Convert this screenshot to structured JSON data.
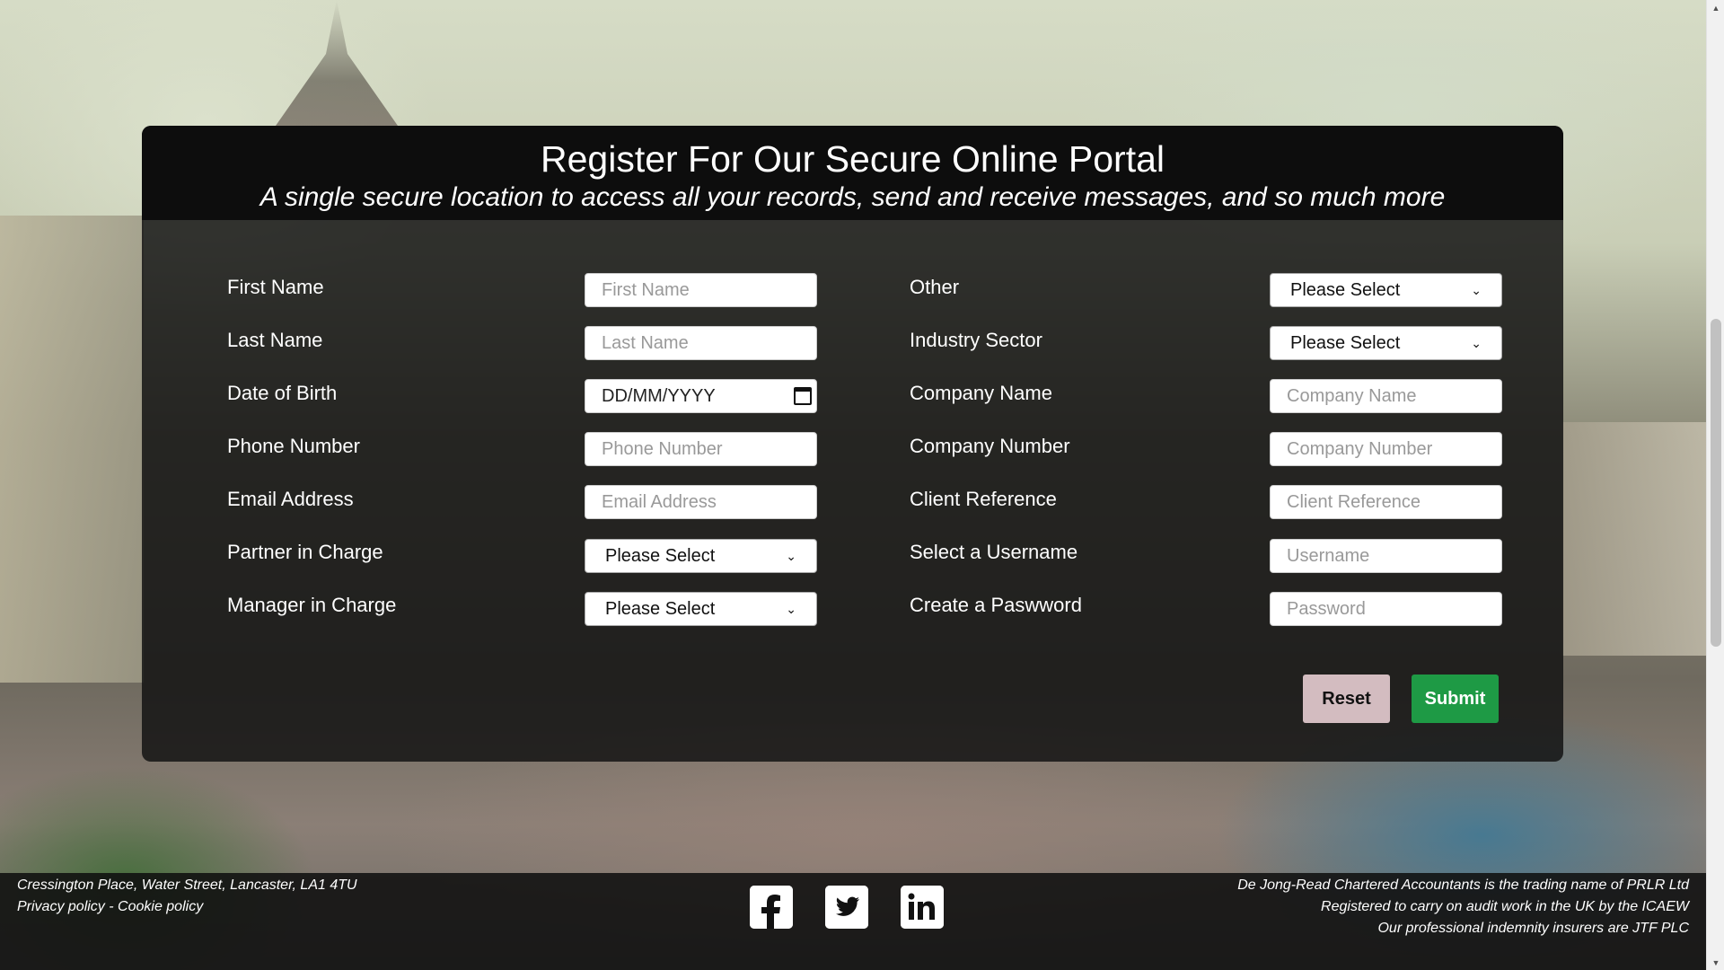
{
  "header": {
    "title": "Register For Our Secure Online Portal",
    "subtitle": "A single secure location to access all your records, send and receive messages, and so much more"
  },
  "form": {
    "left": [
      {
        "label": "First Name",
        "type": "text",
        "placeholder": "First Name"
      },
      {
        "label": "Last Name",
        "type": "text",
        "placeholder": "Last Name"
      },
      {
        "label": "Date of Birth",
        "type": "date",
        "value": "DD/MM/YYYY"
      },
      {
        "label": "Phone Number",
        "type": "text",
        "placeholder": "Phone Number"
      },
      {
        "label": "Email Address",
        "type": "text",
        "placeholder": "Email Address"
      },
      {
        "label": "Partner in Charge",
        "type": "select",
        "value": "Please Select"
      },
      {
        "label": "Manager in Charge",
        "type": "select",
        "value": "Please Select"
      }
    ],
    "right": [
      {
        "label": "Other",
        "type": "select",
        "value": "Please Select"
      },
      {
        "label": "Industry Sector",
        "type": "select",
        "value": "Please Select"
      },
      {
        "label": "Company Name",
        "type": "text",
        "placeholder": "Company Name"
      },
      {
        "label": "Company Number",
        "type": "text",
        "placeholder": "Company Number"
      },
      {
        "label": "Client Reference",
        "type": "text",
        "placeholder": "Client Reference"
      },
      {
        "label": "Select a Username",
        "type": "text",
        "placeholder": "Username"
      },
      {
        "label": "Create a Paswword",
        "type": "text",
        "placeholder": "Password"
      }
    ],
    "reset_label": "Reset",
    "submit_label": "Submit"
  },
  "footer": {
    "address": "Cressington Place, Water Street, Lancaster, LA1 4TU",
    "privacy_label": "Privacy policy",
    "separator": " - ",
    "cookie_label": "Cookie policy",
    "right_lines": [
      "De Jong-Read Chartered Accountants is the trading name of PRLR Ltd",
      "Registered to carry on audit work in the UK by the ICAEW",
      "Our professional indemnity insurers are JTF PLC"
    ],
    "social_icons": [
      "facebook-icon",
      "twitter-icon",
      "linkedin-icon"
    ]
  },
  "colors": {
    "submit": "#1e9a45",
    "reset": "#d3bcc0",
    "panel": "#121212"
  }
}
